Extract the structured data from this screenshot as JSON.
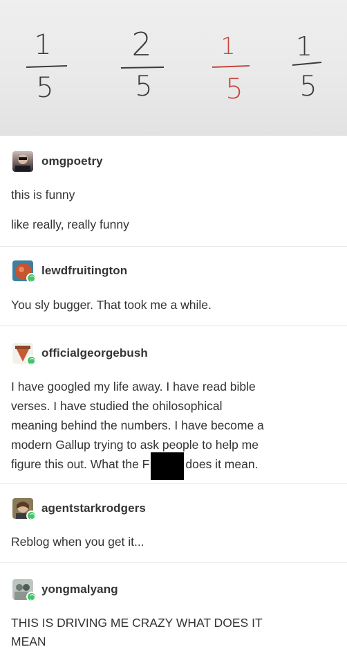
{
  "fractions": [
    {
      "num": "1",
      "den": "5"
    },
    {
      "num": "2",
      "den": "5"
    },
    {
      "num": "1",
      "den": "5"
    },
    {
      "num": "1",
      "den": "5"
    }
  ],
  "posts": [
    {
      "username": "omgpoetry",
      "lines": [
        "this is funny",
        "like really, really funny"
      ]
    },
    {
      "username": "lewdfruitington",
      "lines": [
        "You sly bugger. That took me a while."
      ]
    },
    {
      "username": "officialgeorgebush",
      "lines": [
        "I have googled my life away. I have read bible",
        "verses. I have studied the ohilosophical",
        "meaning behind the numbers. I have become a",
        "modern Gallup trying to ask people to help me",
        "figure this out. What the F",
        "does it mean."
      ]
    },
    {
      "username": "agentstarkrodgers",
      "lines": [
        "Reblog when you get it..."
      ]
    },
    {
      "username": "yongmalyang",
      "lines": [
        "THIS IS DRIVING ME CRAZY WHAT DOES IT",
        "MEAN"
      ]
    }
  ],
  "colors": {
    "reblog_badge": "#46c46b",
    "text": "#333333",
    "ink": "#3b3b3b",
    "red_ink": "#c4473f"
  },
  "icons": {
    "reblog": "reblog-badge-icon",
    "redaction": "black-box"
  }
}
